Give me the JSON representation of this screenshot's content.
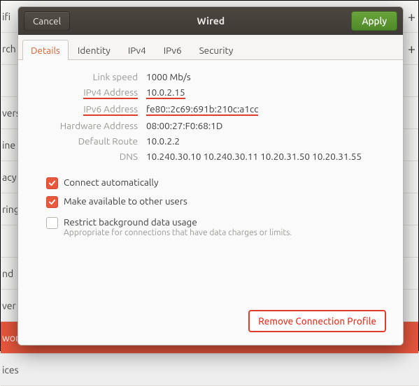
{
  "behind_items": [
    "ifi",
    "rch",
    "",
    "vers",
    "ine A",
    "acy",
    "ring",
    "",
    "nd",
    "ver",
    "wor",
    "ices"
  ],
  "behind_selected_index": 10,
  "titlebar": {
    "cancel": "Cancel",
    "title": "Wired",
    "apply": "Apply"
  },
  "tabs": [
    "Details",
    "Identity",
    "IPv4",
    "IPv6",
    "Security"
  ],
  "active_tab": 0,
  "details": {
    "link_speed_label": "Link speed",
    "link_speed": "1000 Mb/s",
    "ipv4_label": "IPv4 Address",
    "ipv4": "10.0.2.15",
    "ipv6_label": "IPv6 Address",
    "ipv6": "fe80::2c69:691b:210c:a1cc",
    "hw_label": "Hardware Address",
    "hw": "08:00:27:F0:68:1D",
    "route_label": "Default Route",
    "route": "10.0.2.2",
    "dns_label": "DNS",
    "dns": "10.240.30.10 10.240.30.11 10.20.31.50 10.20.31.55"
  },
  "checks": {
    "auto": {
      "label": "Connect automatically",
      "checked": true
    },
    "share": {
      "label": "Make available to other users",
      "checked": true
    },
    "metered": {
      "label": "Restrict background data usage",
      "sub": "Appropriate for connections that have data charges or limits.",
      "checked": false
    }
  },
  "remove": "Remove Connection Profile"
}
